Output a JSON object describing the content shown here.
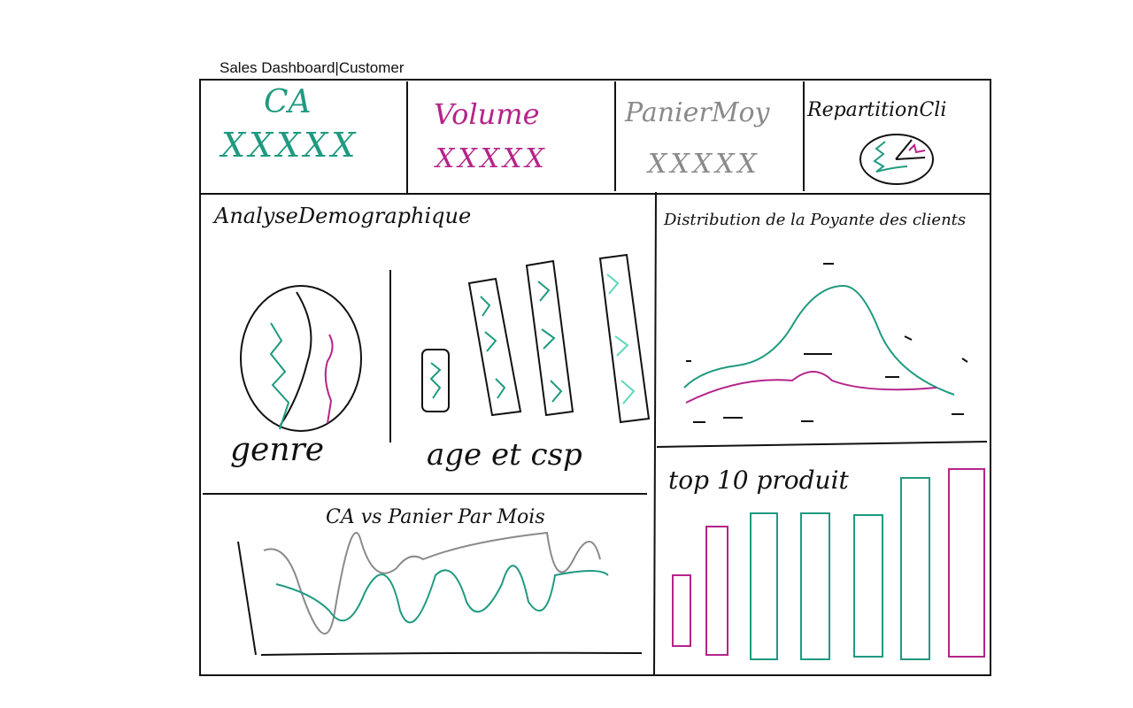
{
  "header": {
    "title": "Sales Dashboard|Customer"
  },
  "kpis": [
    {
      "label": "CA",
      "value": "XXXXX",
      "color": "#1f9a80"
    },
    {
      "label": "Volume",
      "value": "XXXXX",
      "color": "#b5248a"
    },
    {
      "label": "PanierMoy",
      "value": "XXXXX",
      "color": "#8a8a8a"
    },
    {
      "label": "RepartitionCli",
      "icon": "pie-chart-icon",
      "color": "#111111"
    }
  ],
  "panels": {
    "demographics": {
      "title": "AnalyseDemographique",
      "gender_label": "genre",
      "age_label": "age et csp"
    },
    "distribution": {
      "title": "Distribution de la Poyante des clients"
    },
    "monthly": {
      "title": "CA vs Panier Par Mois"
    },
    "top_products": {
      "title": "top 10 produit"
    }
  },
  "colors": {
    "teal": "#1f9a80",
    "magenta": "#b5248a",
    "gray": "#8a8a8a",
    "light_teal": "#5fd6bd"
  }
}
